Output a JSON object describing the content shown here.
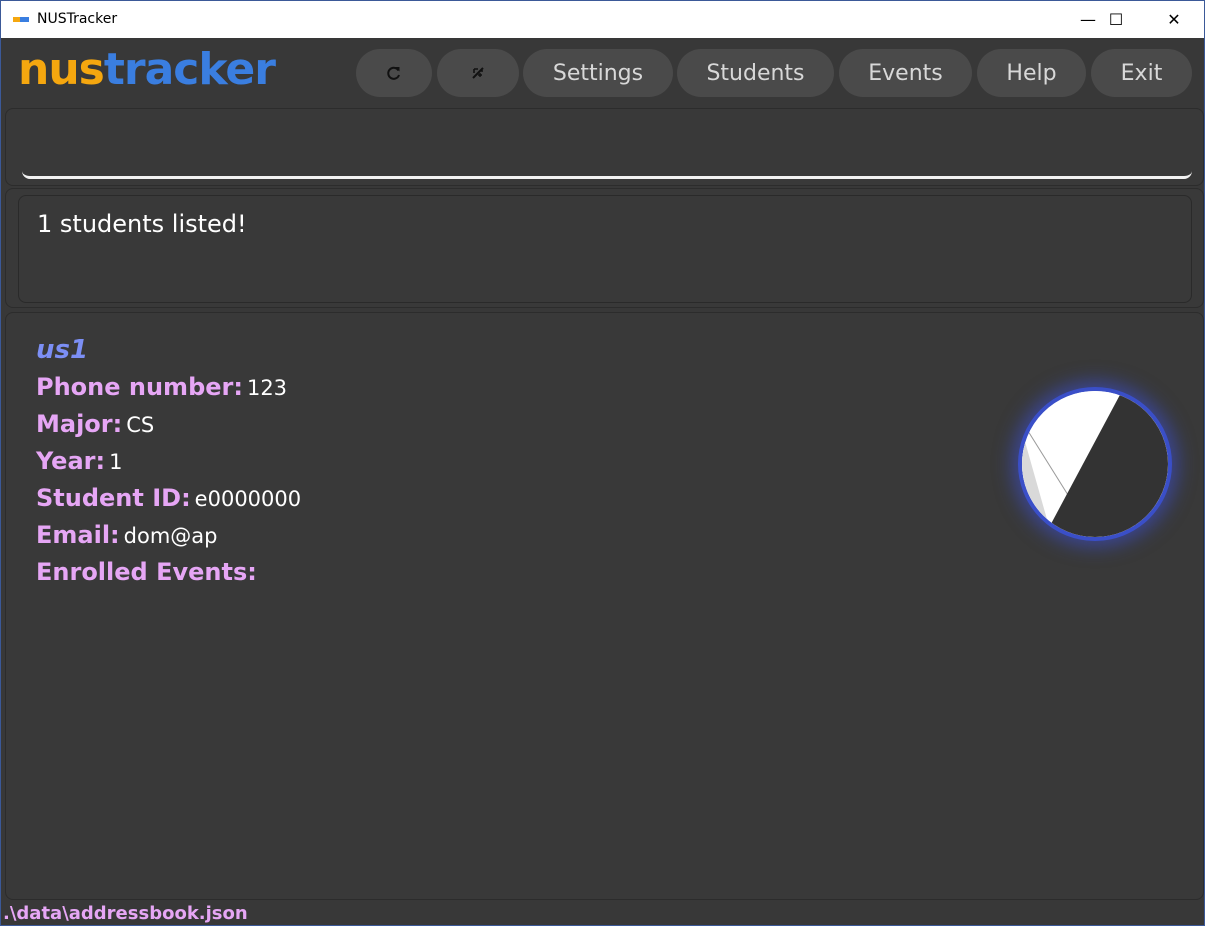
{
  "window": {
    "title": "NUSTracker",
    "minimize_glyph": "—",
    "maximize_glyph": "☐",
    "close_glyph": "✕"
  },
  "logo": {
    "part1": "nus",
    "part2": "tracker"
  },
  "nav": {
    "refresh_icon": "refresh-icon",
    "theme_icon": "theme-toggle-icon",
    "settings": "Settings",
    "students": "Students",
    "events": "Events",
    "help": "Help",
    "exit": "Exit"
  },
  "command": {
    "value": "",
    "placeholder": ""
  },
  "result": {
    "message": "1 students listed!"
  },
  "students": [
    {
      "name": "us1",
      "phone_label": "Phone number:",
      "phone": "123",
      "major_label": "Major:",
      "major": "CS",
      "year_label": "Year:",
      "year": "1",
      "id_label": "Student ID:",
      "id": "e0000000",
      "email_label": "Email:",
      "email": "dom@ap",
      "events_label": "Enrolled Events:",
      "events": ""
    }
  ],
  "status": {
    "file_path": ".\\data\\addressbook.json"
  },
  "colors": {
    "background": "#383838",
    "accent_orange": "#f5a70f",
    "accent_blue": "#3a7ee0",
    "name_blue": "#7c8ff5",
    "label_pink": "#e6a6f5",
    "avatar_ring": "#3a4fc8"
  }
}
